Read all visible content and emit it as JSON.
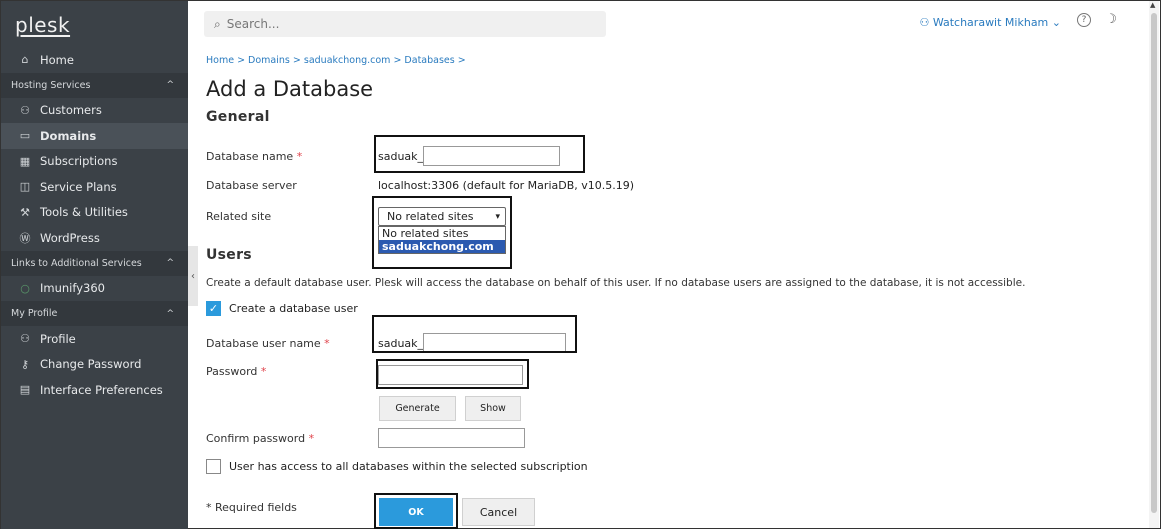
{
  "sidebar": {
    "brand": "plesk",
    "home": "Home",
    "groups": {
      "hosting": "Hosting Services",
      "links": "Links to Additional Services",
      "profile": "My Profile"
    },
    "items": {
      "customers": "Customers",
      "domains": "Domains",
      "subscriptions": "Subscriptions",
      "service_plans": "Service Plans",
      "tools": "Tools & Utilities",
      "wordpress": "WordPress",
      "imunify": "Imunify360",
      "profile": "Profile",
      "change_password": "Change Password",
      "interface_prefs": "Interface Preferences"
    }
  },
  "topbar": {
    "search_placeholder": "Search...",
    "user_name": "Watcharawit Mikham"
  },
  "breadcrumb": "Home > Domains > saduakchong.com > Databases >",
  "page_title": "Add a Database",
  "general": {
    "title": "General",
    "db_name_label": "Database name",
    "db_name_prefix": "saduak_",
    "db_server_label": "Database server",
    "db_server_value": "localhost:3306 (default for MariaDB, v10.5.19)",
    "related_site_label": "Related site",
    "related_site_selected": "No related sites",
    "related_site_options": [
      "No related sites",
      "saduakchong.com"
    ]
  },
  "users": {
    "title": "Users",
    "description": "Create a default database user. Plesk will access the database on behalf of this user. If no database users are assigned to the database, it is not accessible.",
    "create_user_label": "Create a database user",
    "user_name_label": "Database user name",
    "user_name_prefix": "saduak_",
    "password_label": "Password",
    "generate_label": "Generate",
    "show_label": "Show",
    "confirm_label": "Confirm password",
    "access_all_label": "User has access to all databases within the selected subscription"
  },
  "required_note": "* Required fields",
  "ok_label": "OK",
  "cancel_label": "Cancel",
  "colors": {
    "sidebar_bg": "#3b4147",
    "accent": "#2b9adc",
    "link": "#2a7bbf",
    "required": "#e0434b"
  }
}
